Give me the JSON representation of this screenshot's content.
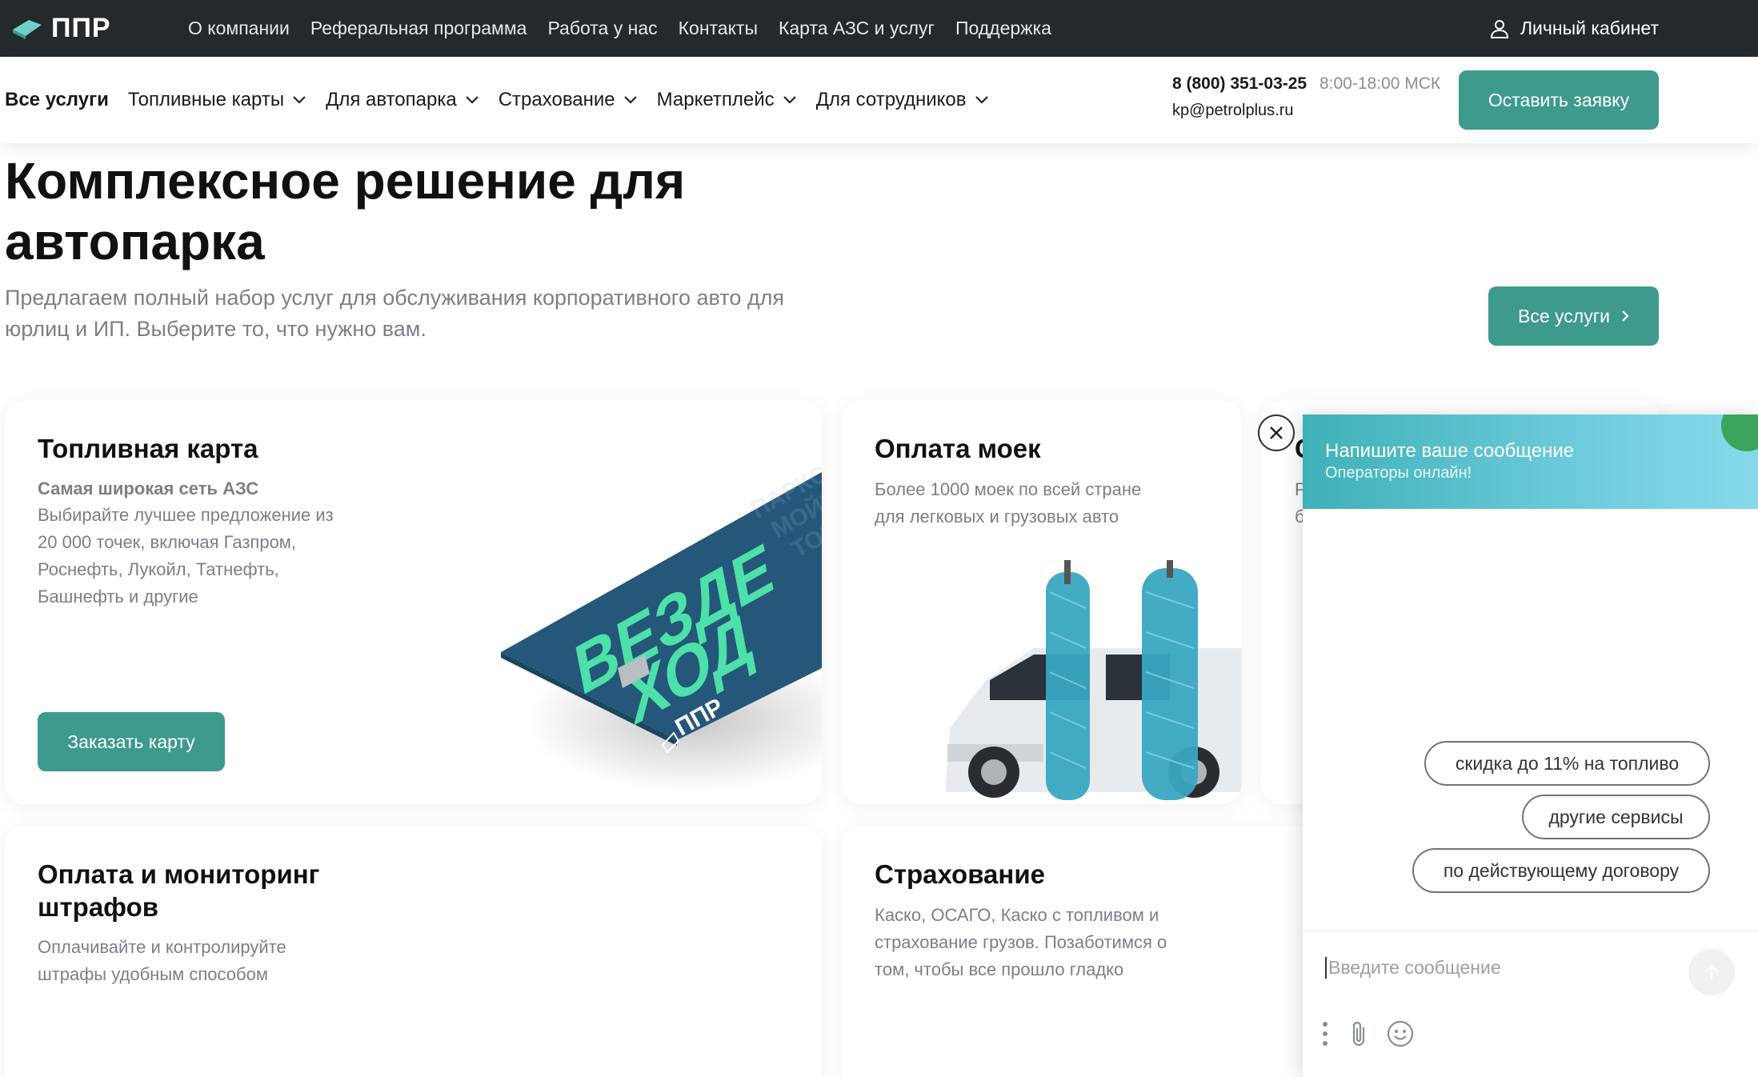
{
  "topbar": {
    "logo_text": "ППР",
    "nav": [
      "О компании",
      "Реферальная программа",
      "Работа у нас",
      "Контакты",
      "Карта АЗС и услуг",
      "Поддержка"
    ],
    "account_label": "Личный кабинет"
  },
  "subnav": {
    "items": [
      "Все услуги",
      "Топливные карты",
      "Для автопарка",
      "Страхование",
      "Маркетплейс",
      "Для сотрудников"
    ],
    "phone": "8 (800) 351-03-25",
    "hours": "8:00-18:00 МСК",
    "email": "kp@petrolplus.ru",
    "request_button": "Оставить заявку"
  },
  "hero": {
    "title": "Комплексное решение для автопарка",
    "subtitle": "Предлагаем полный набор услуг для обслуживания корпоративного авто для юрлиц и ИП. Выберите то, что нужно вам.",
    "all_services_button": "Все услуги"
  },
  "cards": {
    "fuel": {
      "title": "Топливная карта",
      "subtitle": "Самая широкая сеть АЗС",
      "lines": [
        "Выбирайте лучшее предложение из",
        "20 000 точек, включая Газпром,",
        "Роснефть, Лукойл, Татнефть,",
        "Башнефть и другие"
      ],
      "button": "Заказать карту",
      "card_word1": "ВЕЗДЕ",
      "card_word2": "ХОД",
      "card_logo": "ППР"
    },
    "wash": {
      "title": "Оплата моек",
      "lines": [
        "Более 1000 моек по всей стране",
        "для легковых и грузовых авто"
      ]
    },
    "third": {
      "title_partial": "С",
      "line1_partial": "Р",
      "line2_partial": "б"
    },
    "fines": {
      "title_lines": [
        "Оплата и мониторинг",
        "штрафов"
      ],
      "lines": [
        "Оплачивайте и контролируйте",
        "штрафы удобным способом"
      ]
    },
    "insurance": {
      "title": "Страхование",
      "lines": [
        "Каско, ОСАГО, Каско с топливом и",
        "страхование грузов. Позаботимся о",
        "том, чтобы все прошло гладко"
      ]
    }
  },
  "chat": {
    "title": "Напишите ваше сообщение",
    "status": "Операторы онлайн!",
    "chips": [
      "скидка до 11% на топливо",
      "другие сервисы",
      "по действующему договору"
    ],
    "input_placeholder": "Введите сообщение"
  },
  "colors": {
    "accent": "#3d9a8d",
    "topbar": "#24292b",
    "card_blue": "#24577a",
    "card_green": "#4de0a8",
    "brush_blue": "#3aa6c2"
  }
}
